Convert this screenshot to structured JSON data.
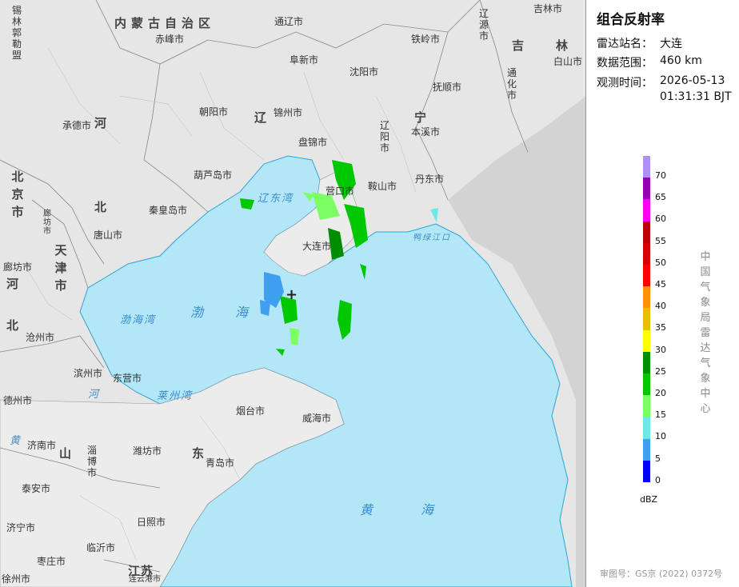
{
  "map": {
    "provinces": [
      {
        "name": "内蒙古自治区",
        "id": "inner-mongolia"
      },
      {
        "name": "吉",
        "id": "jilin-1"
      },
      {
        "name": "林",
        "id": "jilin-2"
      },
      {
        "name": "辽",
        "id": "liaoning-1"
      },
      {
        "name": "宁",
        "id": "liaoning-2"
      },
      {
        "name": "河",
        "id": "hebei-1"
      },
      {
        "name": "北",
        "id": "hebei-2"
      },
      {
        "name": "北京市",
        "id": "beijing"
      },
      {
        "name": "天津市",
        "id": "tianjin"
      },
      {
        "name": "河",
        "id": "hebei-3"
      },
      {
        "name": "北",
        "id": "hebei-4"
      },
      {
        "name": "山",
        "id": "shandong-1"
      },
      {
        "name": "东",
        "id": "shandong-2"
      },
      {
        "name": "江苏",
        "id": "jiangsu"
      }
    ],
    "cities": {
      "xilinhaote": "锡林郭勒盟",
      "chifeng": "赤峰市",
      "tongliao": "通辽市",
      "tieling": "铁岭市",
      "liaoyuan": "辽源市",
      "jilin": "吉林市",
      "baishan": "白山市",
      "tonghua": "通化市",
      "fuxin": "阜新市",
      "shenyang": "沈阳市",
      "fushun": "抚顺市",
      "chengde": "承德市",
      "chaoyang": "朝阳市",
      "jinzhou": "锦州市",
      "liaoyang": "辽阳市",
      "benxi": "本溪市",
      "panjin": "盘锦市",
      "huludao": "葫芦岛市",
      "yingkou": "营口市",
      "anshan": "鞍山市",
      "dandong": "丹东市",
      "qinhuangdao": "秦皇岛市",
      "langfang": "廊坊市",
      "tangshan": "唐山市",
      "dalian": "大连市",
      "cangzhou": "沧州市",
      "binzhou": "滨州市",
      "dongying": "东营市",
      "dezhou": "德州市",
      "yantai": "烟台市",
      "weihai": "威海市",
      "jinan": "济南市",
      "zibo": "淄博市",
      "weifang": "潍坊市",
      "qingdao": "青岛市",
      "taian": "泰安市",
      "jining": "济宁市",
      "rizhao": "日照市",
      "linyi": "临沂市",
      "zaozhuang": "枣庄市",
      "lianyungang": "连云港市",
      "xuzhou": "徐州市"
    },
    "seas": {
      "liaodong": "辽东湾",
      "bohai_bay": "渤海湾",
      "bohai": "渤海",
      "laizhou": "莱州湾",
      "yellow": "黄海",
      "xikou": "鸭绿江口",
      "river_he": "河",
      "river_huang": "黄"
    }
  },
  "panel": {
    "title": "组合反射率",
    "station_label": "雷达站名：",
    "station_value": "大连",
    "range_label": "数据范围：",
    "range_value": "460 km",
    "time_label": "观测时间：",
    "time_date": "2026-05-13",
    "time_clock": "01:31:31 BJT",
    "legend_ticks": [
      "70",
      "65",
      "60",
      "55",
      "50",
      "45",
      "40",
      "35",
      "30",
      "25",
      "20",
      "15",
      "10",
      "5",
      "0"
    ],
    "legend_colors": [
      "#ad90f0",
      "#9600b4",
      "#ff00f0",
      "#c00000",
      "#d60000",
      "#ff0000",
      "#ff9000",
      "#e7c000",
      "#ffff00",
      "#008e00",
      "#00c800",
      "#7cff65",
      "#6ee7e7",
      "#3f9ff0",
      "#0000f6"
    ],
    "unit": "dBZ",
    "agency": "中国气象局雷达气象中心",
    "credit": "审图号：GS京 (2022) 0372号"
  }
}
